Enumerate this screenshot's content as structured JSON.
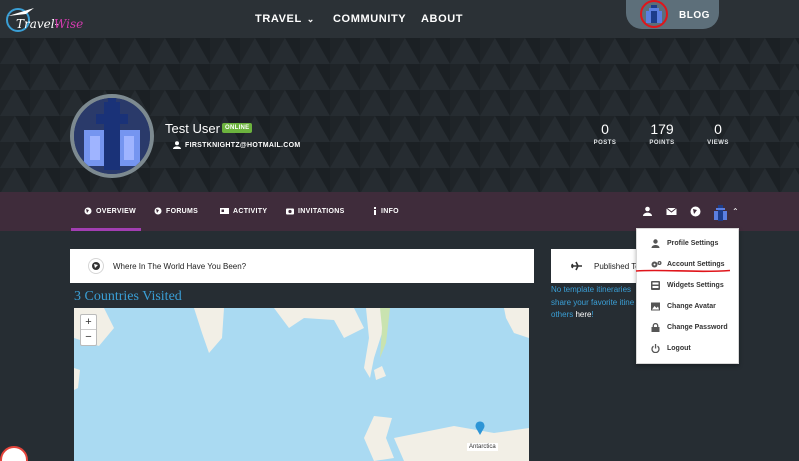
{
  "nav": {
    "logo_text": "Travel-Wise",
    "travel": "TRAVEL",
    "community": "COMMUNITY",
    "about": "ABOUT",
    "blog": "BLOG"
  },
  "profile": {
    "name": "Test User",
    "status": "ONLINE",
    "email": "FIRSTKNIGHTZ@HOTMAIL.COM",
    "stats": [
      {
        "value": "0",
        "label": "POSTS"
      },
      {
        "value": "179",
        "label": "POINTS"
      },
      {
        "value": "0",
        "label": "VIEWS"
      }
    ]
  },
  "tabs": {
    "overview": "OVERVIEW",
    "forums": "FORUMS",
    "activity": "ACTIVITY",
    "invitations": "INVITATIONS",
    "info": "INFO"
  },
  "main": {
    "where_title": "Where In The World Have You Been?",
    "countries_visited": "3 Countries Visited",
    "published_title": "Published Te",
    "side_line1": "No template itineraries",
    "side_line2": "share your favorite itine",
    "side_line3_pre": "others ",
    "side_line3_link": "here",
    "side_line3_post": "!",
    "zoom_in": "+",
    "zoom_out": "−",
    "map_label": "Antarctica"
  },
  "dropdown": {
    "items": [
      {
        "label": "Profile Settings",
        "icon": "user-icon"
      },
      {
        "label": "Account Settings",
        "icon": "gears-icon"
      },
      {
        "label": "Widgets Settings",
        "icon": "widgets-icon"
      },
      {
        "label": "Change Avatar",
        "icon": "image-icon"
      },
      {
        "label": "Change Password",
        "icon": "lock-icon"
      },
      {
        "label": "Logout",
        "icon": "power-icon"
      }
    ]
  },
  "colors": {
    "accent_purple": "#a23eb2",
    "link_blue": "#3a9fd6",
    "online_green": "#6cb33e",
    "annotation_red": "#e0151b"
  }
}
